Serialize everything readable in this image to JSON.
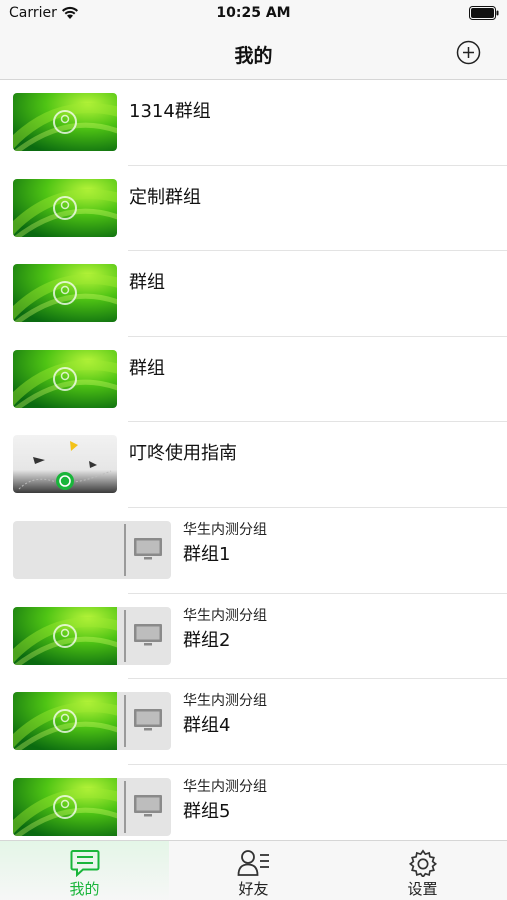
{
  "status_bar": {
    "carrier": "Carrier",
    "time": "10:25 AM"
  },
  "nav": {
    "title": "我的"
  },
  "groups": [
    {
      "title": "1314群组",
      "thumb": "green-image"
    },
    {
      "title": "定制群组",
      "thumb": "green-image"
    },
    {
      "title": "群组",
      "thumb": "green-image"
    },
    {
      "title": "群组",
      "thumb": "green-image"
    },
    {
      "title": "叮咚使用指南",
      "thumb": "guide-image"
    },
    {
      "subtitle": "华生内测分组",
      "title": "群组1",
      "thumb": "grey-tv"
    },
    {
      "subtitle": "华生内测分组",
      "title": "群组2",
      "thumb": "green-tv"
    },
    {
      "subtitle": "华生内测分组",
      "title": "群组4",
      "thumb": "green-tv"
    },
    {
      "subtitle": "华生内测分组",
      "title": "群组5",
      "thumb": "green-tv"
    }
  ],
  "tabs": [
    {
      "label": "我的",
      "icon": "chat-icon",
      "active": true
    },
    {
      "label": "好友",
      "icon": "contacts-icon",
      "active": false
    },
    {
      "label": "设置",
      "icon": "gear-icon",
      "active": false
    }
  ],
  "colors": {
    "accent": "#19b53a",
    "thumb_green_dark": "#0d7a12",
    "thumb_green_light": "#8ee81a"
  }
}
